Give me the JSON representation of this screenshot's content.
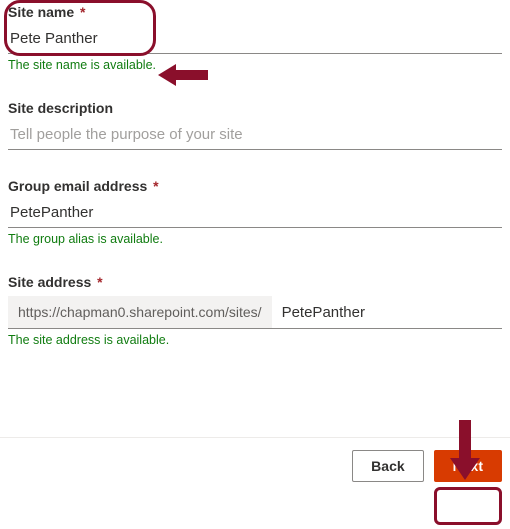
{
  "fields": {
    "site_name": {
      "label": "Site name",
      "required_mark": "*",
      "value": "Pete Panther",
      "validation": "The site name is available."
    },
    "site_description": {
      "label": "Site description",
      "placeholder": "Tell people the purpose of your site",
      "value": ""
    },
    "group_email": {
      "label": "Group email address",
      "required_mark": "*",
      "value": "PetePanther",
      "validation": "The group alias is available."
    },
    "site_address": {
      "label": "Site address",
      "required_mark": "*",
      "prefix": "https://chapman0.sharepoint.com/sites/",
      "value": "PetePanther",
      "validation": "The site address is available."
    }
  },
  "footer": {
    "back_label": "Back",
    "next_label": "Next"
  },
  "annotations": {
    "highlight_site_name": true,
    "arrow_to_validation": true,
    "highlight_next": true,
    "arrow_to_next": true,
    "color": "#8a0f2b"
  }
}
